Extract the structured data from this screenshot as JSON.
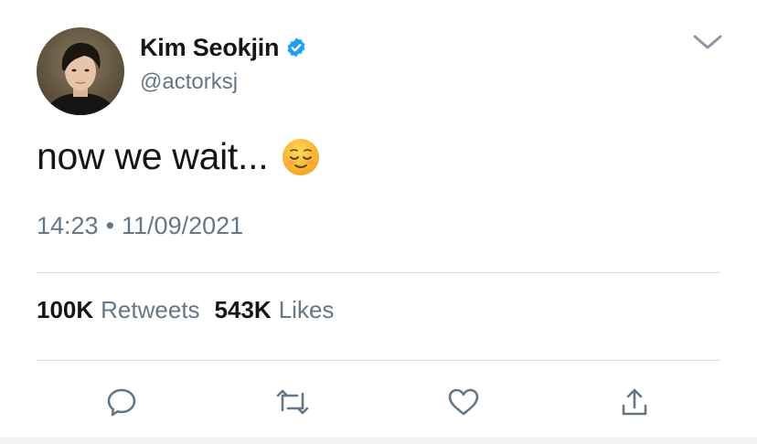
{
  "tweet": {
    "author": {
      "display_name": "Kim Seokjin",
      "handle": "@actorksj",
      "verified": true
    },
    "text": "now we wait...",
    "emoji": "relieved-face",
    "time": "14:23",
    "separator": "•",
    "date": "11/09/2021",
    "stats": {
      "retweets_count": "100K",
      "retweets_label": "Retweets",
      "likes_count": "543K",
      "likes_label": "Likes"
    },
    "actions": [
      "reply-icon",
      "retweet-icon",
      "like-icon",
      "share-icon"
    ]
  },
  "colors": {
    "text_primary": "#14171a",
    "text_secondary": "#657786",
    "verified_blue": "#1da1f2",
    "divider": "#d6dde3",
    "icon_gray": "#657786"
  }
}
